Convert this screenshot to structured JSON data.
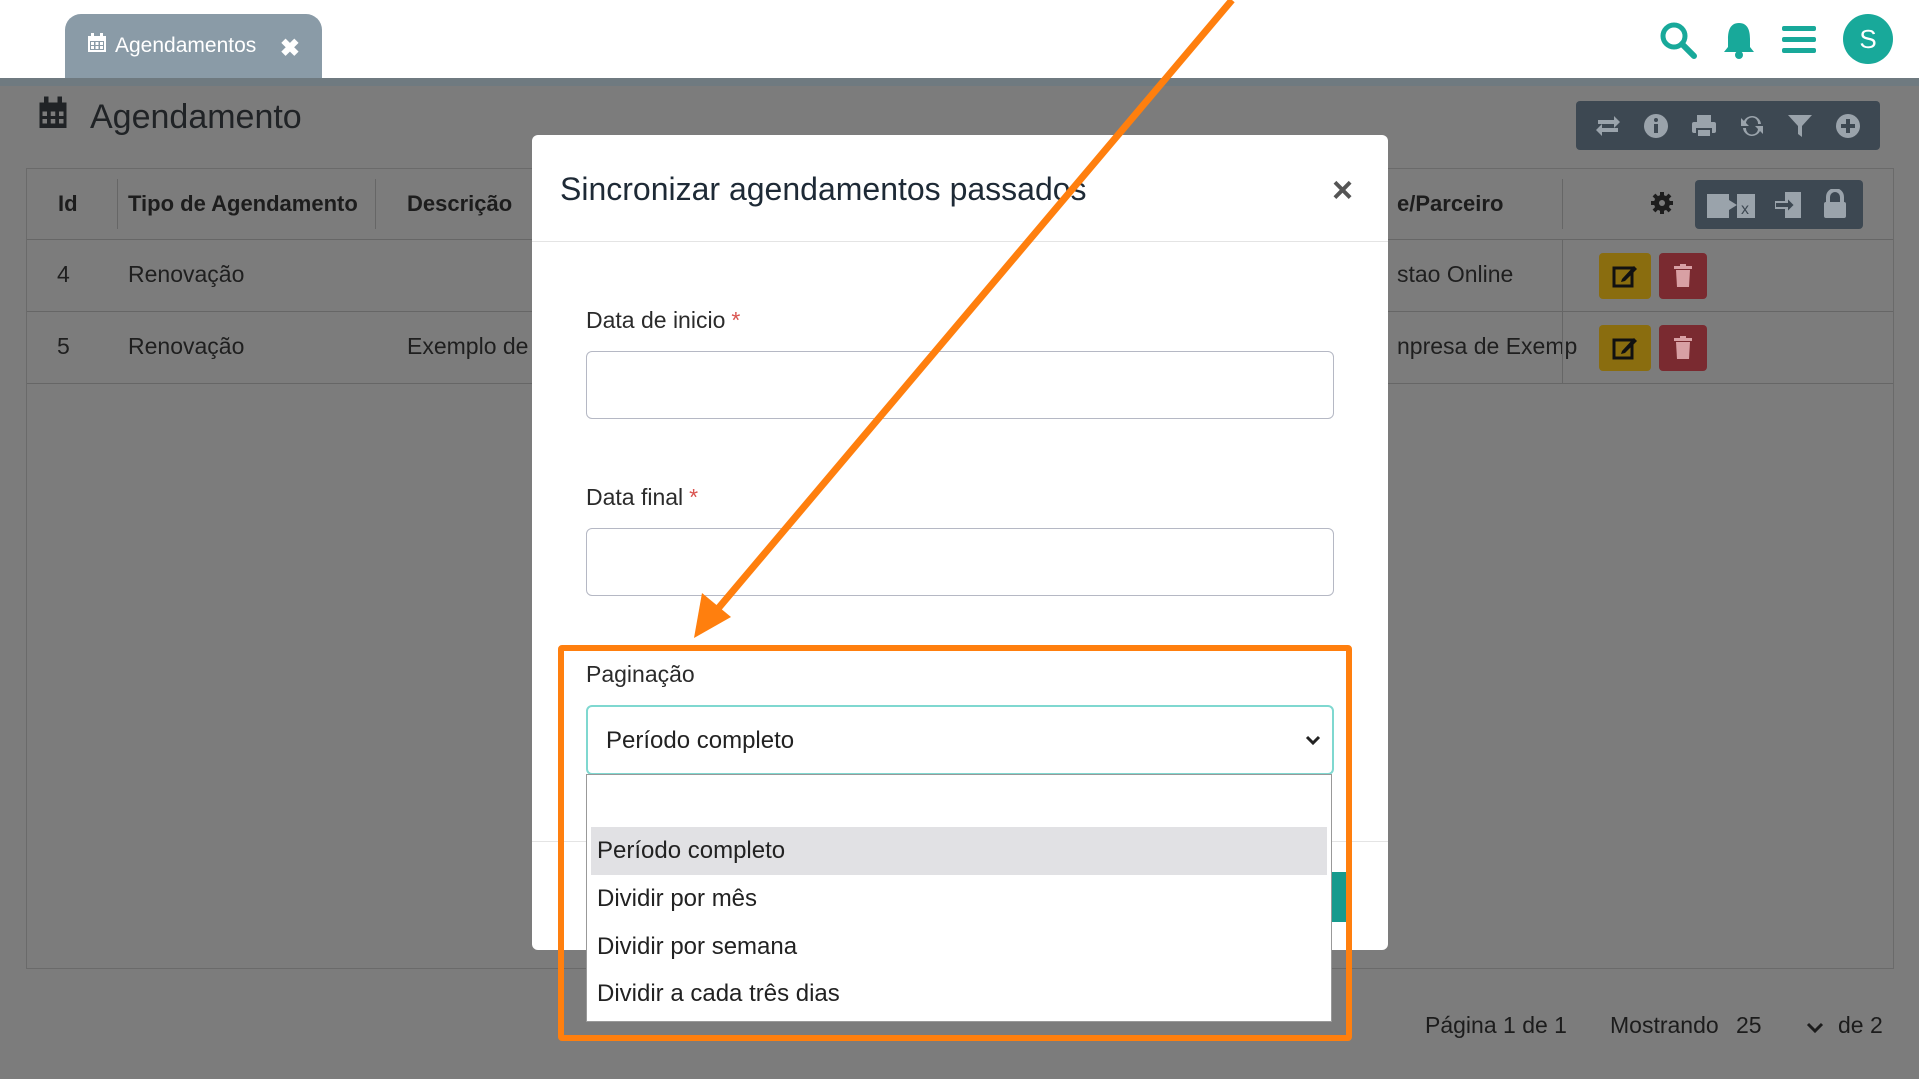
{
  "tab": {
    "label": "Agendamentos"
  },
  "user": {
    "initial": "S"
  },
  "page": {
    "title": "Agendamento"
  },
  "table": {
    "headers": {
      "id": "Id",
      "tipo": "Tipo de Agendamento",
      "descricao": "Descrição",
      "parceiro": "e/Parceiro"
    },
    "rows": [
      {
        "id": "4",
        "tipo": "Renovação",
        "descricao": "",
        "parceiro": "stao Online"
      },
      {
        "id": "5",
        "tipo": "Renovação",
        "descricao": "Exemplo de",
        "parceiro": "npresa de Exemp"
      }
    ]
  },
  "pager": {
    "page_text": "Página 1 de 1",
    "showing_label": "Mostrando",
    "per_page": "25",
    "of_text": "de 2"
  },
  "modal": {
    "title": "Sincronizar agendamentos passados",
    "close": "×",
    "start_label": "Data de inicio",
    "end_label": "Data final",
    "required_mark": "*",
    "pagination_label": "Paginação",
    "pagination_value": "Período completo",
    "options": [
      "Período completo",
      "Dividir por mês",
      "Dividir por semana",
      "Dividir a cada três dias"
    ]
  },
  "icons": {
    "tab": "calendar-icon",
    "tab_close": "close-icon",
    "top": [
      "search-icon",
      "bell-icon",
      "menu-icon"
    ],
    "toolbar": [
      "repeat-icon",
      "info-icon",
      "print-icon",
      "refresh-icon",
      "filter-icon",
      "plus-icon"
    ],
    "column_tools": [
      "gear-icon",
      "excel-export-icon",
      "import-icon",
      "lock-icon"
    ],
    "row_actions": [
      "edit-icon",
      "trash-icon"
    ]
  },
  "colors": {
    "teal": "#18a99a",
    "highlight": "#ff7f0e",
    "edit": "#8a6d0f",
    "delete": "#7a2a30"
  }
}
